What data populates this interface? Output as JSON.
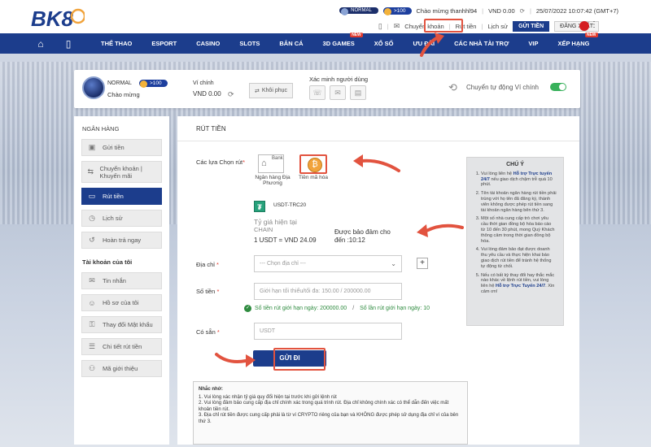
{
  "brand": {
    "logo_text": "BK8",
    "accent": "#1c3d8c",
    "highlight": "#e2533f"
  },
  "topbar": {
    "tier": "NORMAL",
    "level": ">100",
    "greeting": "Chào mừng thanhhl94",
    "balance": "VND 0.00",
    "datetime": "25/07/2022 10:07:42 (GMT+7)",
    "links": [
      "Chuyển khoản",
      "Rút tiền",
      "Lịch sử"
    ],
    "deposit_btn": "GỬI TIỀN",
    "logout_btn": "ĐĂNG XUẤT"
  },
  "nav": {
    "items": [
      {
        "label": "THỂ THAO"
      },
      {
        "label": "ESPORT"
      },
      {
        "label": "CASINO"
      },
      {
        "label": "SLOTS"
      },
      {
        "label": "BẮN CÁ"
      },
      {
        "label": "3D GAMES",
        "hot": "NEW"
      },
      {
        "label": "XỔ SỐ"
      },
      {
        "label": "ƯU ĐÃI"
      },
      {
        "label": "CÁC NHÀ TÀI TRỢ"
      },
      {
        "label": "VIP"
      },
      {
        "label": "XẾP HẠNG",
        "hot": "NEW"
      }
    ]
  },
  "profile": {
    "tier": "NORMAL",
    "level": ">100",
    "hello": "Chào mừng",
    "wallet_label": "Ví chính",
    "wallet_value": "VND 0.00",
    "restore_btn": "Khôi phục",
    "verify_label": "Xác minh người dùng",
    "auto_transfer_label": "Chuyển tự động Ví chính"
  },
  "sidebar": {
    "bank_heading": "NGÂN HÀNG",
    "bank_items": [
      {
        "label": "Gửi tiền",
        "icon": "deposit-icon"
      },
      {
        "label": "Chuyển khoản | Khuyến mãi",
        "icon": "transfer-icon"
      },
      {
        "label": "Rút tiền",
        "icon": "withdraw-icon",
        "active": true
      },
      {
        "label": "Lịch sử",
        "icon": "history-icon"
      },
      {
        "label": "Hoàn trả ngay",
        "icon": "rebate-icon"
      }
    ],
    "account_heading": "Tài khoản của tôi",
    "account_items": [
      {
        "label": "Tin nhắn",
        "icon": "message-icon"
      },
      {
        "label": "Hồ sơ của tôi",
        "icon": "profile-icon"
      },
      {
        "label": "Thay đổi Mật khẩu",
        "icon": "lock-icon"
      },
      {
        "label": "Chi tiết rút tiền",
        "icon": "detail-icon"
      },
      {
        "label": "Mã giới thiệu",
        "icon": "referral-icon"
      }
    ]
  },
  "form": {
    "title": "RÚT TIỀN",
    "options_label": "Các lựa Chọn rút",
    "option_bank_tag": "Bank",
    "option_bank_caption": "Ngân hàng Địa Phương",
    "option_crypto_caption": "Tiền mã hóa",
    "coin_label": "USDT-TRC20",
    "rate_label": "Tỷ giá hiện tại",
    "rate_chain": "CHAIN",
    "rate_value": "1 USDT = VND 24.09",
    "guarantee_label": "Được bảo đảm cho",
    "guarantee_until": "đến :10:12",
    "address_label": "Địa chỉ",
    "address_placeholder": "--- Chọn địa chỉ ---",
    "amount_label": "Số tiền",
    "amount_placeholder": "Giới hạn tối thiểu/tối đa: 150.00 / 200000.00",
    "limit_day": "Số tiền rút giới hạn ngày: 200000.00",
    "limit_count": "Số lần rút giới hạn ngày: 10",
    "available_label": "Có sẵn",
    "available_placeholder": "USDT",
    "submit": "GỬI ĐI"
  },
  "reminder": {
    "title": "Nhắc nhở:",
    "lines": [
      "1. Vui lòng xác nhận tỷ giá quy đổi hiện tại trước khi gửi lệnh rút",
      "2. Vui lòng đảm bảo cung cấp địa chỉ chính xác trong quá trình rút. Địa chỉ không chính xác có thể dẫn đến việc mất khoản tiền rút.",
      "3. Địa chỉ rút tiền được cung cấp phải là từ ví CRYPTO riêng của bạn và KHÔNG được phép sử dụng địa chỉ ví của bên thứ 3."
    ]
  },
  "notes": {
    "title": "CHÚ Ý",
    "items": [
      {
        "pre": "Vui lòng liên hệ ",
        "bold": "Hỗ trợ Trực tuyến 24/7",
        "post": " nếu giao dịch chậm trễ quá 10 phút."
      },
      {
        "pre": "Tên tài khoản ngân hàng rút tiền phải trùng với họ tên đã đăng ký, thành viên không được phép rút tiền sang tài khoản ngân hàng bên thứ 3.",
        "bold": "",
        "post": ""
      },
      {
        "pre": "Một số nhà cung cấp trò chơi yêu cầu thời gian đồng bộ hóa báo cáo từ 10 đến 30 phút, mong Quý Khách thông cảm trong thời gian đồng bộ hóa.",
        "bold": "",
        "post": ""
      },
      {
        "pre": "Vui lòng đảm bảo đạt được doanh thu yêu cầu và thực hiện khai báo giao dịch rút tiền để tránh hệ thống tự động từ chối.",
        "bold": "",
        "post": ""
      },
      {
        "pre": "Nếu có bất kỳ thay đổi hay thắc mắc nào khác về lệnh rút tiền, vui lòng liên hệ ",
        "bold": "Hỗ trợ Trực Tuyến 24/7",
        "post": ". Xin cảm ơn!"
      }
    ]
  }
}
